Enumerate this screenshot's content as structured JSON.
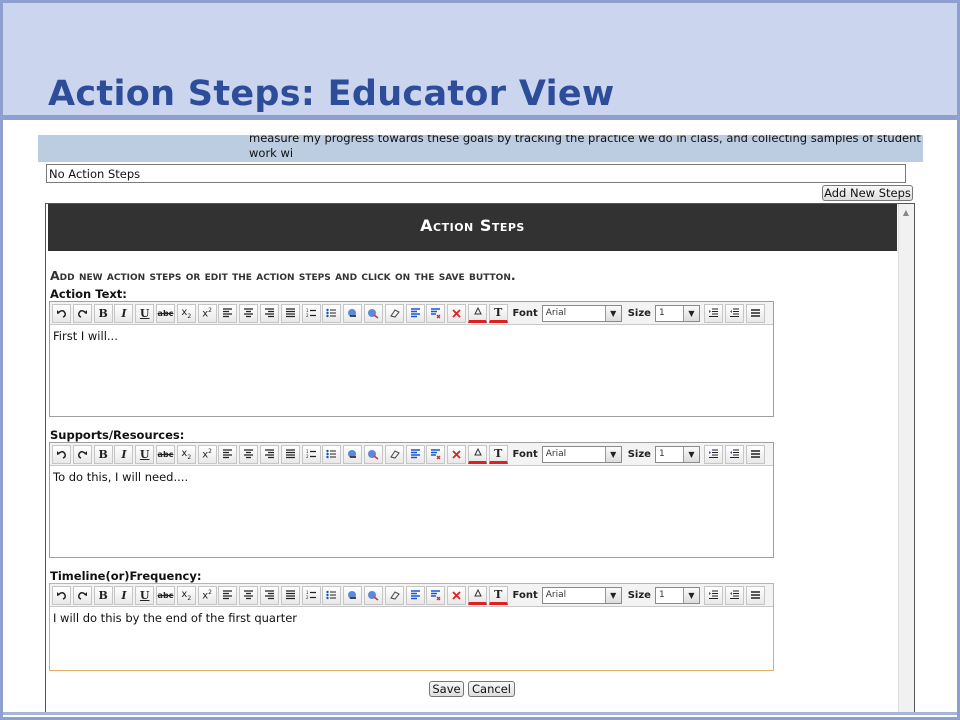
{
  "slide": {
    "title": "Action Steps: Educator View",
    "colors": {
      "header_bg": "#ccd5ee",
      "title": "#2d4d9b",
      "frame": "#8f9fcf"
    }
  },
  "goal": {
    "text_partial": "measure my progress towards these goals by tracking the practice we do in class, and collecting samples of student work wi\nfeedback."
  },
  "steps_list": {
    "empty_text": "No Action Steps",
    "add_button_label": "Add New Steps"
  },
  "dialog": {
    "title": "Action Steps",
    "instruction": "Add new action steps or edit the action steps and click on the save button.",
    "fields": [
      {
        "label": "Action Text:",
        "content": "First I will..."
      },
      {
        "label": "Supports/Resources:",
        "content": "To do this, I will need...."
      },
      {
        "label": "Timeline(or)Frequency:",
        "content": "I will do this by the end of the first quarter"
      }
    ],
    "toolbar": {
      "font_label": "Font",
      "font_value": "Arial",
      "size_label": "Size",
      "size_value": "1",
      "icons": [
        "undo-icon",
        "redo-icon",
        "bold-icon",
        "italic-icon",
        "underline-icon",
        "strikethrough-icon",
        "subscript-icon",
        "superscript-icon",
        "align-left-icon",
        "align-center-icon",
        "align-right-icon",
        "justify-icon",
        "ordered-list-icon",
        "unordered-list-icon",
        "link-icon",
        "unlink-icon",
        "eraser-icon",
        "format-icon",
        "clear-format-icon",
        "delete-icon",
        "highlight-color-icon",
        "text-color-icon"
      ]
    },
    "save_label": "Save",
    "cancel_label": "Cancel"
  }
}
